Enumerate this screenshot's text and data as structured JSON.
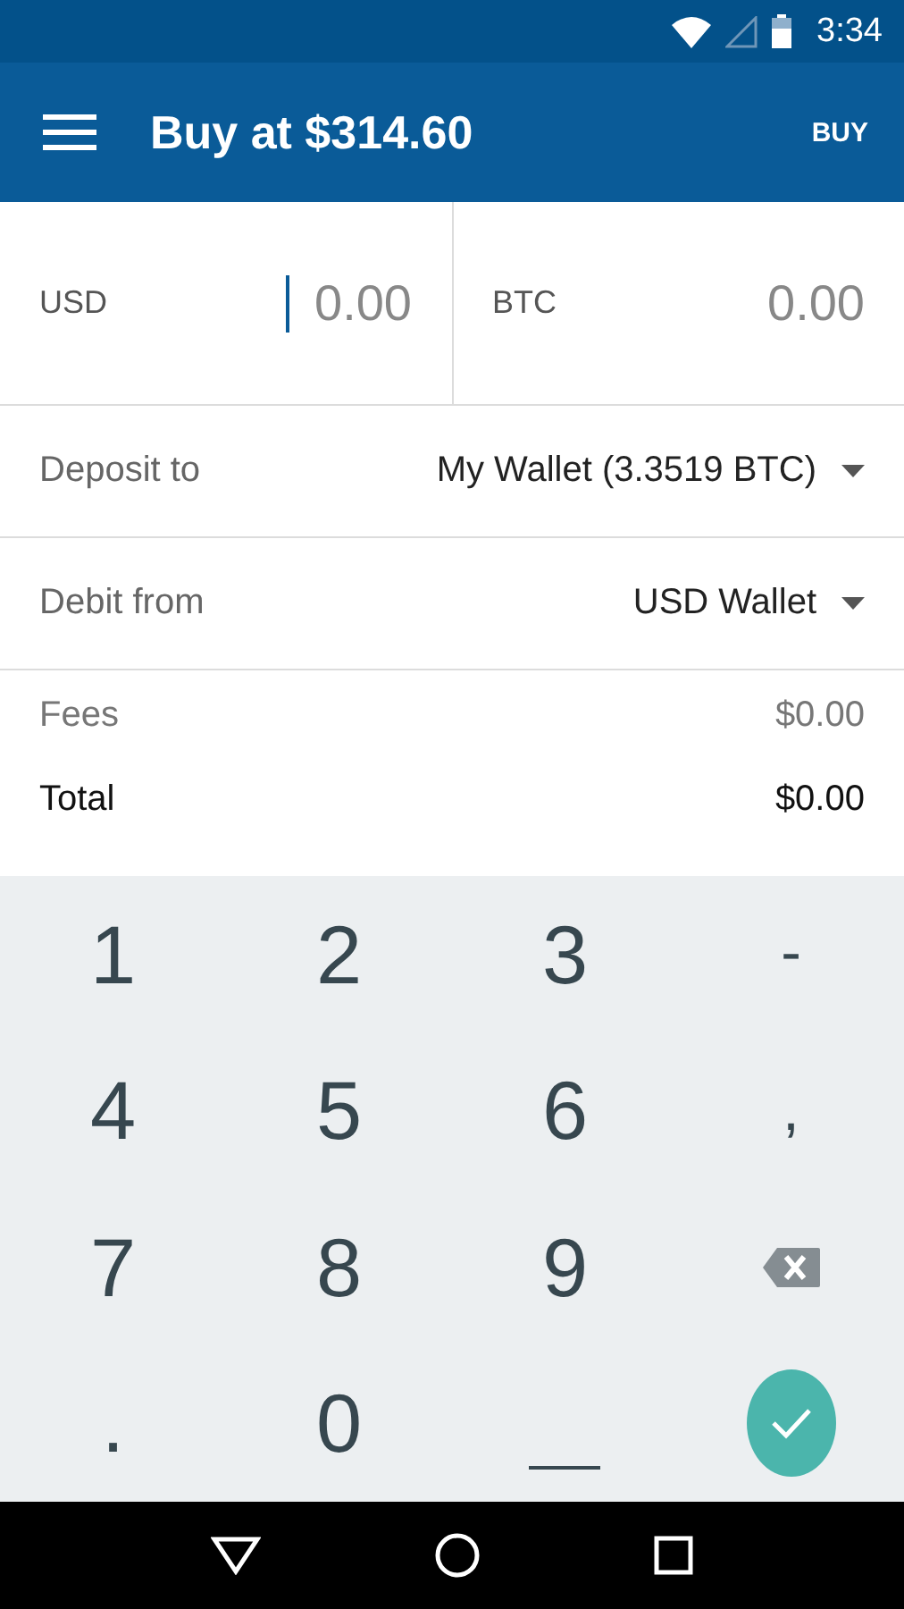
{
  "status_bar": {
    "time": "3:34"
  },
  "app_bar": {
    "title": "Buy at $314.60",
    "action": "BUY"
  },
  "amounts": [
    {
      "currency": "USD",
      "placeholder": "0.00",
      "focused": true
    },
    {
      "currency": "BTC",
      "placeholder": "0.00",
      "focused": false
    }
  ],
  "selectors": [
    {
      "label": "Deposit to",
      "value": "My Wallet (3.3519 BTC)"
    },
    {
      "label": "Debit from",
      "value": "USD Wallet"
    }
  ],
  "summary": [
    {
      "label": "Fees",
      "value": "$0.00",
      "emphasis": false
    },
    {
      "label": "Total",
      "value": "$0.00",
      "emphasis": true
    }
  ],
  "keypad": [
    {
      "kind": "char",
      "label": "1"
    },
    {
      "kind": "char",
      "label": "2"
    },
    {
      "kind": "char",
      "label": "3"
    },
    {
      "kind": "char",
      "label": "-"
    },
    {
      "kind": "char",
      "label": "4"
    },
    {
      "kind": "char",
      "label": "5"
    },
    {
      "kind": "char",
      "label": "6"
    },
    {
      "kind": "char",
      "label": ","
    },
    {
      "kind": "char",
      "label": "7"
    },
    {
      "kind": "char",
      "label": "8"
    },
    {
      "kind": "char",
      "label": "9"
    },
    {
      "kind": "backspace"
    },
    {
      "kind": "char",
      "label": "."
    },
    {
      "kind": "char",
      "label": "0"
    },
    {
      "kind": "space"
    },
    {
      "kind": "done"
    }
  ]
}
